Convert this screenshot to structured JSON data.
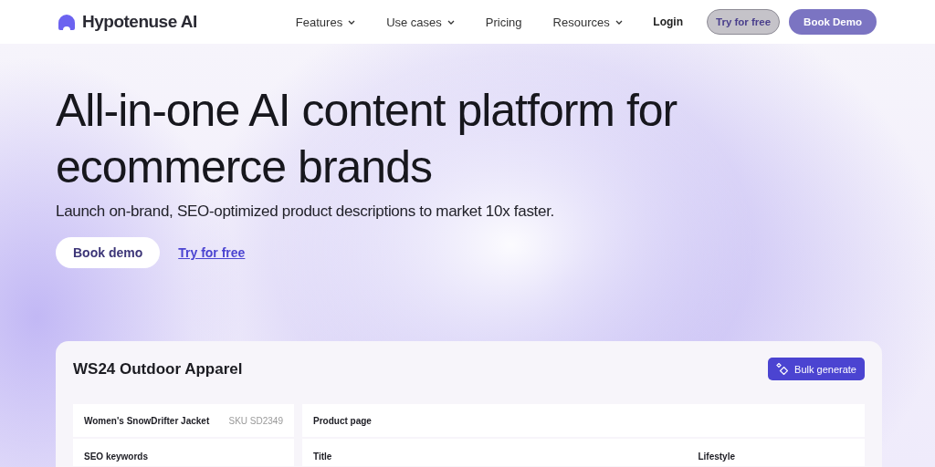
{
  "nav": {
    "brand": "Hypotenuse AI",
    "links": [
      {
        "label": "Features",
        "dropdown": true
      },
      {
        "label": "Use cases",
        "dropdown": true
      },
      {
        "label": "Pricing",
        "dropdown": false
      },
      {
        "label": "Resources",
        "dropdown": true
      }
    ],
    "login": "Login",
    "try_free": "Try for free",
    "book_demo": "Book Demo"
  },
  "hero": {
    "headline": "All-in-one AI content platform for ecommerce brands",
    "subtitle": "Launch on-brand, SEO-optimized product descriptions to market 10x faster.",
    "book_demo": "Book demo",
    "try_free": "Try for free"
  },
  "card": {
    "title": "WS24 Outdoor Apparel",
    "bulk_generate": "Bulk generate",
    "product_name": "Women's SnowDrifter Jacket",
    "sku": "SKU SD2349",
    "seo_label": "SEO keywords",
    "product_page": "Product page",
    "title_label": "Title",
    "style_label": "Lifestyle"
  }
}
